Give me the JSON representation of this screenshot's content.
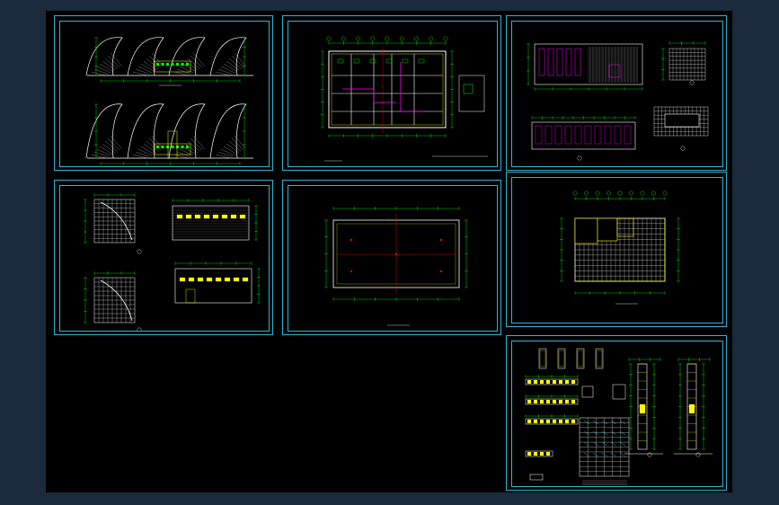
{
  "colors": {
    "frame_outer": "#1b2a3c",
    "drawing_background": "#000000",
    "sheet_border": "#2fb5d4",
    "line_white": "#ffffff",
    "line_green": "#00ff00",
    "line_yellow": "#ffff00",
    "line_magenta": "#ff00ff",
    "line_red": "#ff0000",
    "line_cyan": "#00ffff"
  },
  "sheets": [
    {
      "name": "elevations-sheet",
      "content": "elevation"
    },
    {
      "name": "floor-plan-sheet",
      "content": "plan"
    },
    {
      "name": "interior-elevations-sheet",
      "content": "interior"
    },
    {
      "name": "wall-details-sheet",
      "content": "walls"
    },
    {
      "name": "roof-plan-sheet",
      "content": "roof"
    },
    {
      "name": "grid-plan-sheet",
      "content": "grid"
    },
    {
      "name": "door-window-schedule-sheet",
      "content": "schedule"
    }
  ]
}
